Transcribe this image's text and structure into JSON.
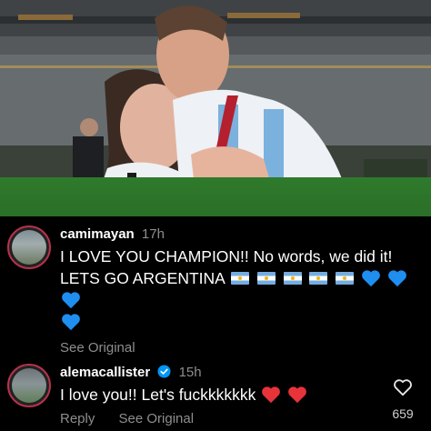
{
  "post": {
    "photo_alt": "Couple at stadium celebration"
  },
  "comments": [
    {
      "username": "camimayan",
      "time": "17h",
      "text_line1": "I LOVE YOU CHAMPION!! No words, we did it!",
      "text_line2": "LETS GO ARGENTINA",
      "flags": [
        "argentina-flag-icon",
        "argentina-flag-icon",
        "argentina-flag-icon",
        "argentina-flag-icon",
        "argentina-flag-icon"
      ],
      "hearts": [
        "blue-heart-icon",
        "blue-heart-icon",
        "blue-heart-icon",
        "blue-heart-icon"
      ],
      "see_original": "See Original",
      "verified": false
    },
    {
      "username": "alemacallister",
      "time": "15h",
      "text": "I love you!! Let's fuckkkkkkk",
      "hearts": [
        "red-heart-icon",
        "red-heart-icon"
      ],
      "reply": "Reply",
      "see_original": "See Original",
      "verified": true,
      "like_count": "659"
    }
  ],
  "colors": {
    "background": "#000000",
    "muted_text": "#8e8e8e",
    "verified_badge": "#0095f6",
    "blue_heart": "#1f8ef1",
    "red_heart": "#e8333a",
    "avatar_ring": "#b7324d"
  }
}
